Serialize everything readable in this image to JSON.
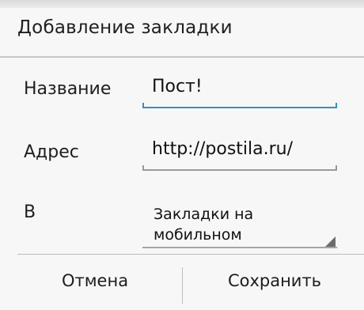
{
  "dialog": {
    "title": "Добавление закладки"
  },
  "form": {
    "name_label": "Название",
    "name_value": "Пост!",
    "address_label": "Адрес",
    "address_value": "http://postila.ru/",
    "folder_label": "В",
    "folder_value": "Закладки на мобильном"
  },
  "buttons": {
    "cancel": "Отмена",
    "save": "Сохранить"
  },
  "colors": {
    "focus_underline": "#3c8cc0",
    "idle_underline": "#9a9a9a"
  }
}
